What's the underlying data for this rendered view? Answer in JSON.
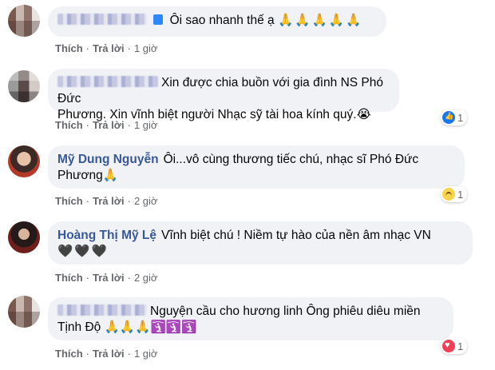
{
  "comments": [
    {
      "author": "",
      "text": "Ôi sao nhanh thế ạ",
      "emojis": "🙏🙏🙏🙏🙏",
      "actions": {
        "like": "Thích",
        "reply": "Trả lời",
        "time": "1 giờ"
      },
      "reaction_count": ""
    },
    {
      "author": "",
      "text_line1": "Xin được chia buồn với gia đình NS Phó Đức",
      "text_line2": "Phương. Xin vĩnh biệt người Nhạc sỹ tài hoa kính quý.😭",
      "actions": {
        "like": "Thích",
        "reply": "Trả lời",
        "time": "1 giờ"
      },
      "reaction_count": "1",
      "reaction_icon": "like-icon"
    },
    {
      "author": "Mỹ Dung Nguyễn",
      "text_line1": "Ôi...vô cùng thương tiếc chú, nhạc sĩ Phó Đức",
      "text_line2": "Phương🙏",
      "actions": {
        "like": "Thích",
        "reply": "Trả lời",
        "time": "2 giờ"
      },
      "reaction_count": "1",
      "reaction_icon": "sad-icon"
    },
    {
      "author": "Hoàng Thị Mỹ Lệ",
      "text_line1": "Vĩnh biệt chú ! Niềm tự hào của nền âm nhạc VN",
      "text_line2": "🖤🖤🖤",
      "actions": {
        "like": "Thích",
        "reply": "Trả lời",
        "time": "2 giờ"
      },
      "reaction_count": "",
      "reaction_icon": ""
    },
    {
      "author": "",
      "text_line1": "Nguyện cầu cho hương linh Ông phiêu diêu miền",
      "text_line2": "Tịnh Độ 🙏🙏🙏🛐🛐🛐",
      "actions": {
        "like": "Thích",
        "reply": "Trả lời",
        "time": "1 giờ"
      },
      "reaction_count": "1",
      "reaction_icon": "love-icon"
    }
  ],
  "colors": {
    "bubble": "#f0f2f5",
    "meta": "#65676b",
    "like": "#1877f2",
    "love": "#f33e58",
    "sad": "#f7d44c"
  }
}
